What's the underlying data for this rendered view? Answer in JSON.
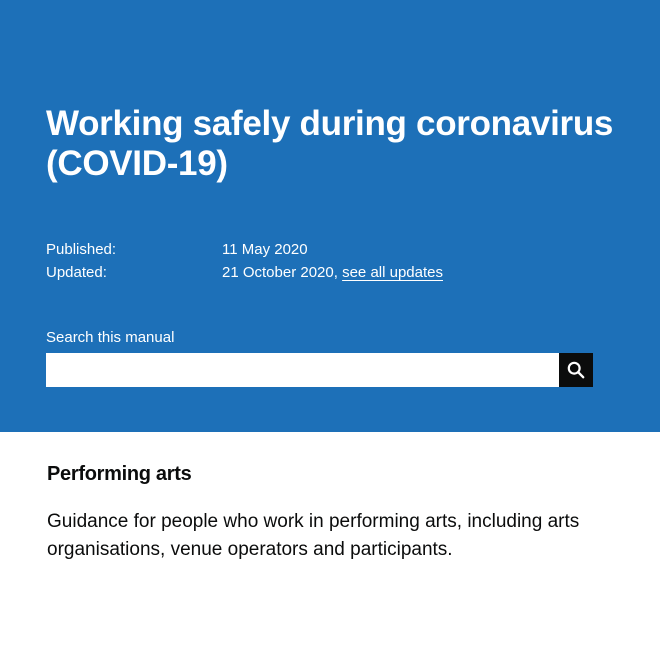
{
  "header": {
    "title": "Working safely during coronavirus (COVID-19)"
  },
  "metadata": {
    "published_label": "Published:",
    "published_value": "11 May 2020",
    "updated_label": "Updated:",
    "updated_value": "21 October 2020,",
    "updates_link": "see all updates"
  },
  "search": {
    "label": "Search this manual",
    "value": "",
    "placeholder": "",
    "button_icon": "search-icon"
  },
  "section": {
    "title": "Performing arts",
    "description": "Guidance for people who work in performing arts, including arts organisations, venue operators and participants."
  },
  "colors": {
    "hero_background": "#1d70b8",
    "search_button": "#0b0c0c",
    "text": "#0b0c0c"
  }
}
